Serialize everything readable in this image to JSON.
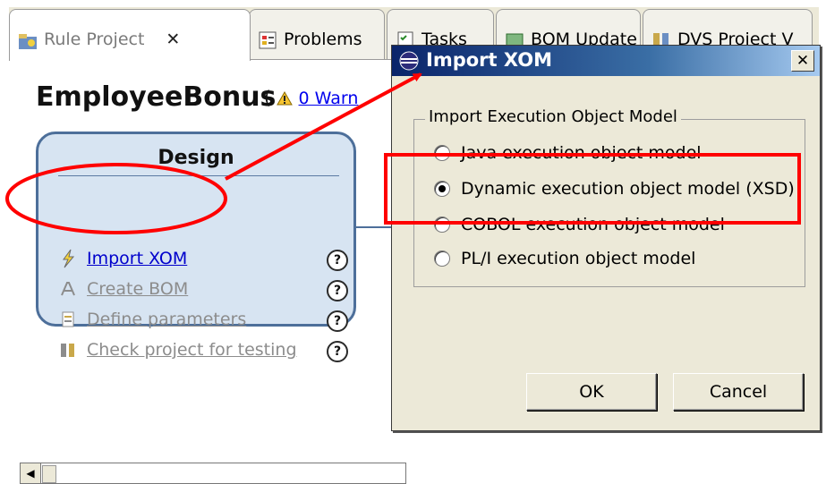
{
  "tabs": [
    {
      "label": "Rule Project",
      "icon": "rule-project-icon",
      "close": "✕",
      "active": true
    },
    {
      "label": "Problems",
      "icon": "problems-icon",
      "active": false
    },
    {
      "label": "Tasks",
      "icon": "tasks-icon",
      "active": false
    },
    {
      "label": "BOM Update",
      "icon": "bom-update-icon",
      "active": false
    },
    {
      "label": "DVS Project V",
      "icon": "dvs-project-icon",
      "active": false
    }
  ],
  "view": {
    "title": "EmployeeBonus",
    "warnings_open": "(",
    "warnings_link": "0 Warn"
  },
  "design": {
    "title": "Design",
    "items": [
      {
        "label": "Import XOM",
        "icon": "lightning-icon",
        "enabled": true,
        "help": "?"
      },
      {
        "label": "Create BOM",
        "icon": "create-bom-icon",
        "enabled": false,
        "help": "?"
      },
      {
        "label": "Define parameters",
        "icon": "parameters-icon",
        "enabled": false,
        "help": "?"
      },
      {
        "label": "Check project for testing",
        "icon": "check-project-icon",
        "enabled": false,
        "help": "?"
      }
    ]
  },
  "scrollbar": {
    "left_arrow": "◀"
  },
  "dialog": {
    "title": "Import XOM",
    "close_label": "✕",
    "group_title": "Import Execution Object Model",
    "options": [
      {
        "label": "Java execution object model",
        "selected": false
      },
      {
        "label": "Dynamic execution object model (XSD)",
        "selected": true
      },
      {
        "label": "COBOL execution object model",
        "selected": false
      },
      {
        "label": "PL/I execution object model",
        "selected": false
      }
    ],
    "ok_label": "OK",
    "cancel_label": "Cancel"
  },
  "colors": {
    "annotation": "#ff0000",
    "title_bar": "#0a246a",
    "design_border": "#4d6f9a",
    "link": "#0000cc"
  }
}
